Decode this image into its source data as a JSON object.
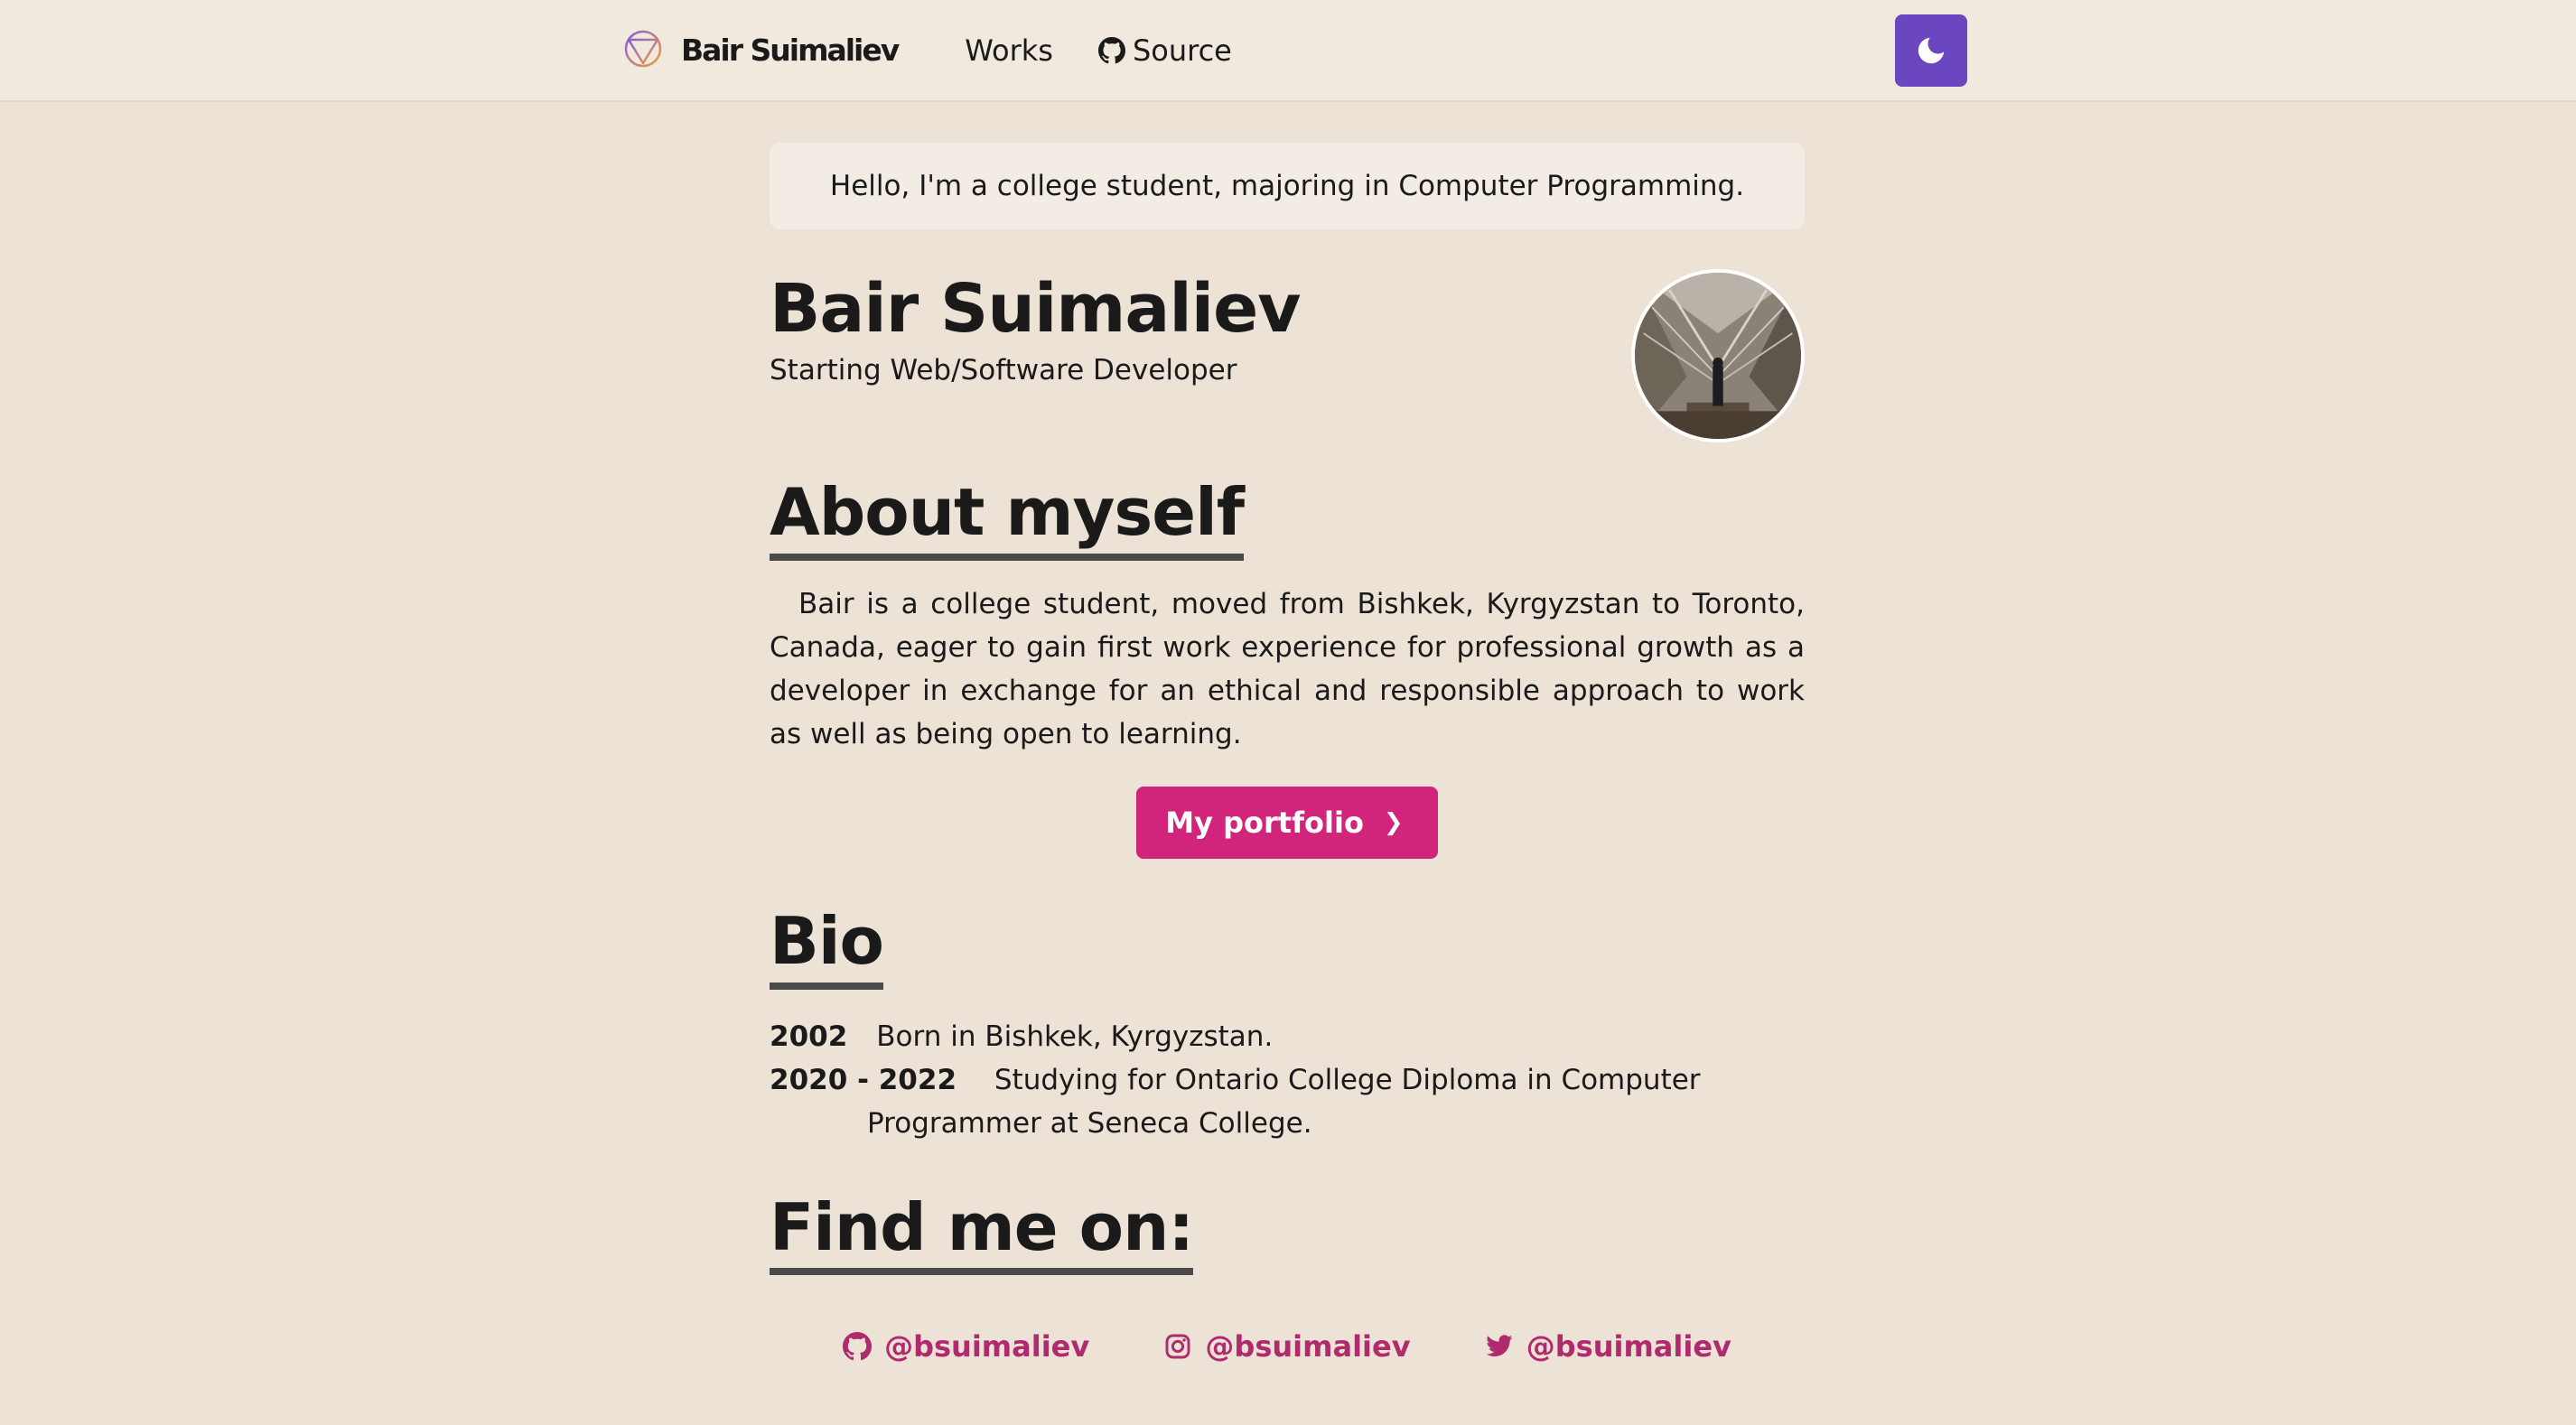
{
  "nav": {
    "logo_text": "Bair Suimaliev",
    "works_label": "Works",
    "source_label": "Source"
  },
  "greeting": "Hello, I'm a college student, majoring in Computer Programming.",
  "profile": {
    "name": "Bair Suimaliev",
    "role": "Starting Web/Software Developer"
  },
  "about": {
    "heading": "About myself",
    "text": "Bair is a college student, moved from Bishkek, Kyrgyzstan to Toronto, Canada, eager to gain first work experience for professional growth as a developer in exchange for an ethical and responsible approach to work as well as being open to learning.",
    "button_label": "My portfolio"
  },
  "bio": {
    "heading": "Bio",
    "items": [
      {
        "year": "2002",
        "text": "Born in Bishkek, Kyrgyzstan."
      },
      {
        "year": "2020 - 2022",
        "text": "Studying for Ontario College Diploma in Computer Programmer at Seneca College."
      }
    ]
  },
  "find": {
    "heading": "Find me on:",
    "links": [
      {
        "icon": "github-icon",
        "handle": "@bsuimaliev"
      },
      {
        "icon": "instagram-icon",
        "handle": "@bsuimaliev"
      },
      {
        "icon": "twitter-icon",
        "handle": "@bsuimaliev"
      }
    ]
  },
  "colors": {
    "accent_purple": "#6b46c1",
    "button_pink": "#d0257b",
    "link_pink": "#b02a6e",
    "background": "#ede2d6"
  }
}
